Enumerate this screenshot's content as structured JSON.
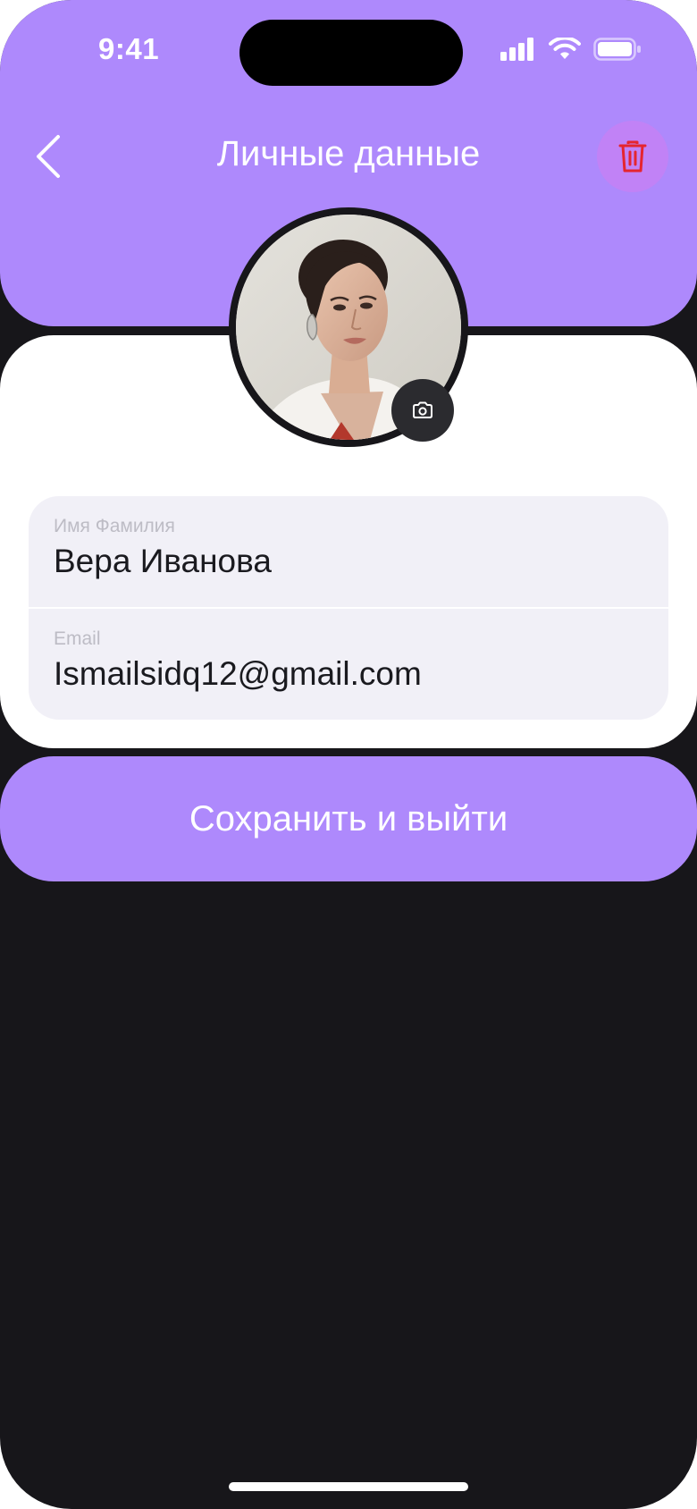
{
  "status_bar": {
    "time": "9:41"
  },
  "header": {
    "title": "Личные данные",
    "back_icon": "chevron-left-icon",
    "delete_icon": "trash-icon"
  },
  "profile": {
    "avatar_alt": "avatar",
    "camera_icon": "camera-icon"
  },
  "form": {
    "name_label": "Имя Фамилия",
    "name_value": "Вера Иванова",
    "email_label": "Email",
    "email_value": "Ismailsidq12@gmail.com"
  },
  "actions": {
    "save_label": "Сохранить и выйти"
  },
  "colors": {
    "accent": "#ae89fc",
    "background": "#17161a",
    "delete": "#e5252f",
    "field_bg": "#f1f0f7"
  }
}
